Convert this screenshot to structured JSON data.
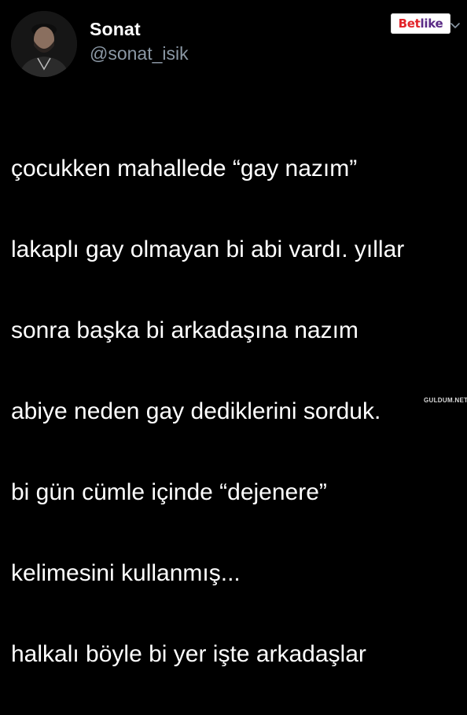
{
  "user": {
    "display_name": "Sonat",
    "handle": "@sonat_isik"
  },
  "brand_badge": {
    "part1": "Bet",
    "part2": "like",
    "color_red": "#e2242a",
    "color_purple": "#5a2a86"
  },
  "tweet": {
    "lines": [
      "çocukken mahallede “gay nazım”",
      "lakaplı gay olmayan bi abi vardı. yıllar",
      "sonra başka bi arkadaşına nazım",
      "abiye neden gay dediklerini sorduk.",
      "bi gün cümle içinde “dejenere”",
      "kelimesini kullanmış...",
      "halkalı böyle bi yer işte arkadaşlar"
    ]
  },
  "watermark": "GULDUM.NET",
  "icons": {
    "menu": "chevron-down-icon",
    "avatar": "user-avatar"
  },
  "colors": {
    "background": "#000000",
    "text": "#ffffff",
    "secondary_text": "#8b98a5"
  }
}
